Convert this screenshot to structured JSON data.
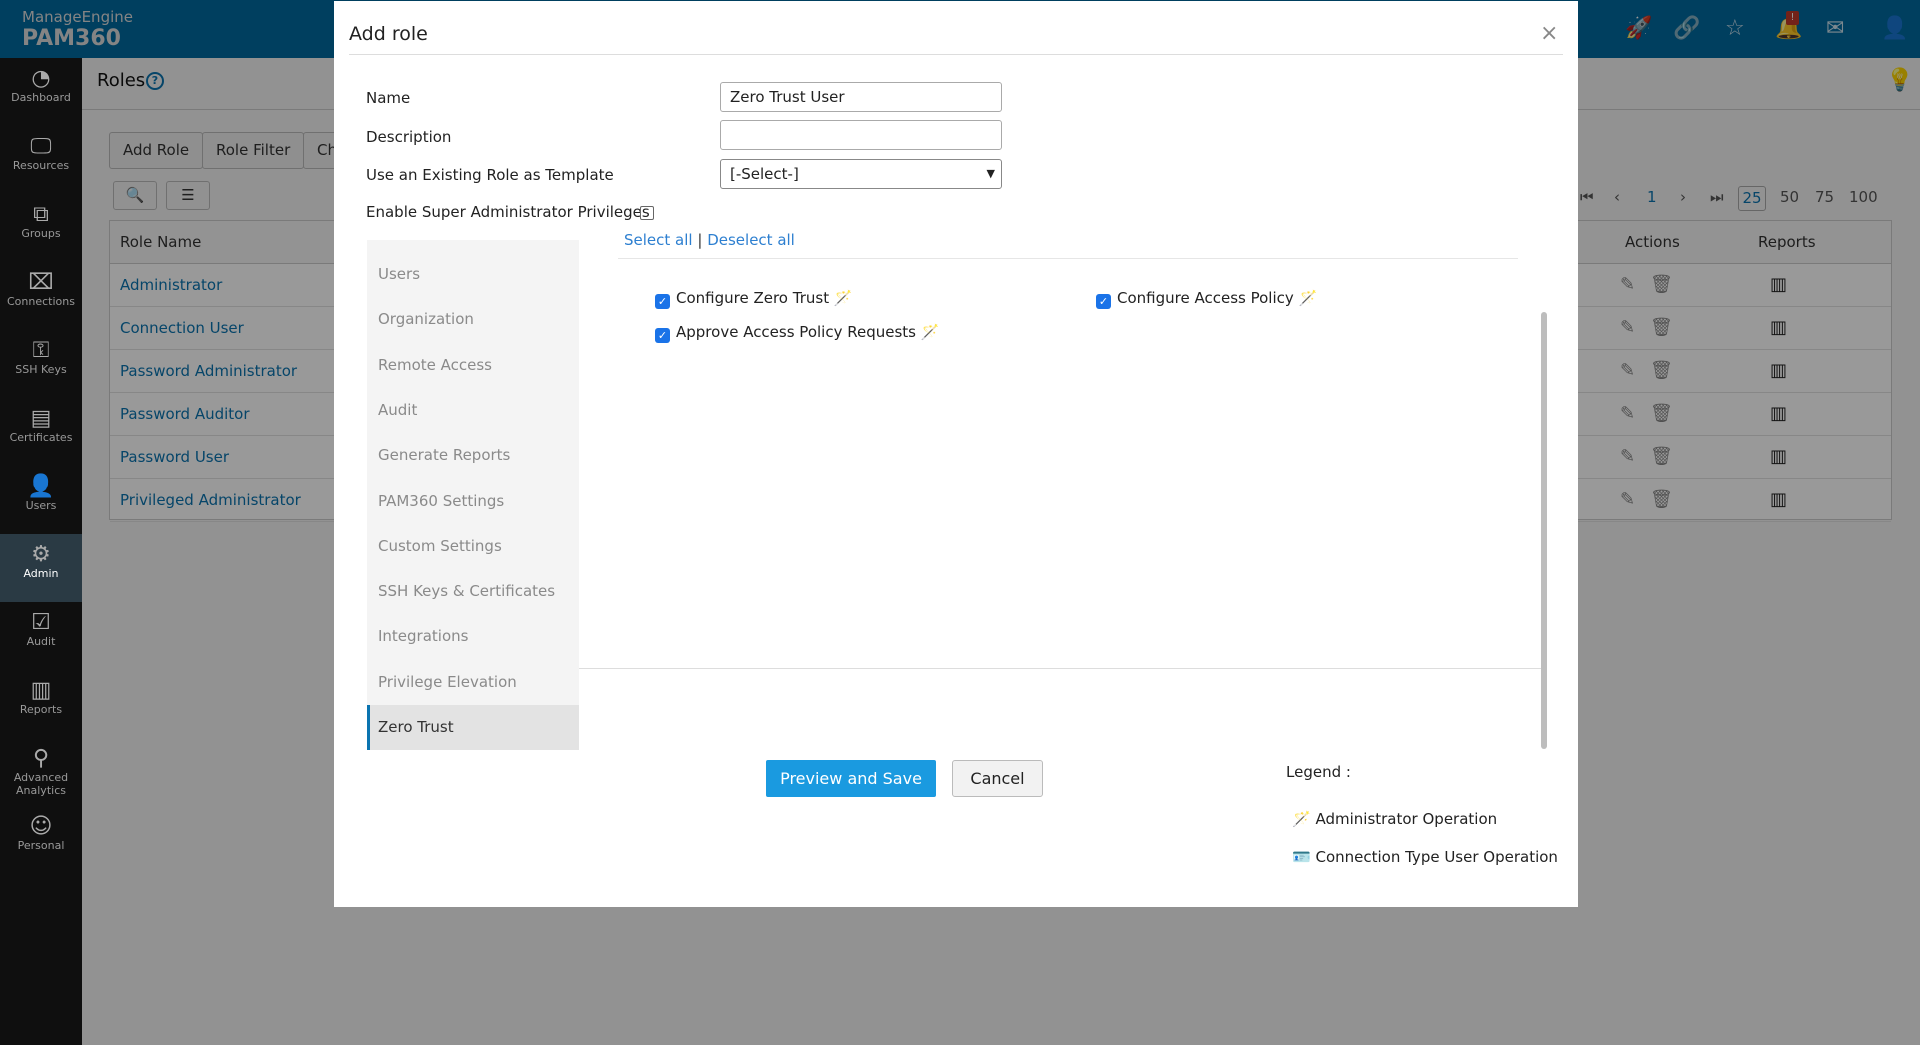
{
  "header": {
    "brand": "ManageEngine",
    "product": "PAM360",
    "icons": [
      "rocket-icon",
      "link-icon",
      "user-star-icon",
      "bell-icon",
      "mail-icon",
      "user-icon"
    ],
    "notification_badge": "!"
  },
  "sidebar": {
    "items": [
      {
        "label": "Dashboard",
        "icon": "◔"
      },
      {
        "label": "Resources",
        "icon": "🖵"
      },
      {
        "label": "Groups",
        "icon": "⧉"
      },
      {
        "label": "Connections",
        "icon": "⌧"
      },
      {
        "label": "SSH Keys",
        "icon": "⚿"
      },
      {
        "label": "Certificates",
        "icon": "▤"
      },
      {
        "label": "Users",
        "icon": "👤"
      },
      {
        "label": "Admin",
        "icon": "⚙",
        "active": true
      },
      {
        "label": "Audit",
        "icon": "☑"
      },
      {
        "label": "Reports",
        "icon": "▥"
      },
      {
        "label": "Advanced Analytics",
        "icon": "⚲"
      },
      {
        "label": "Personal",
        "icon": "☺"
      }
    ]
  },
  "page": {
    "title": "Roles",
    "help": "?",
    "toolbar": {
      "add_role": "Add Role",
      "role_filter": "Role Filter",
      "third": "Ch"
    },
    "table": {
      "headers": {
        "role_name": "Role Name",
        "actions": "Actions",
        "reports": "Reports"
      },
      "rows": [
        "Administrator",
        "Connection User",
        "Password Administrator",
        "Password Auditor",
        "Password User",
        "Privileged Administrator"
      ]
    },
    "pagination": {
      "current": "1",
      "sizes": [
        "25",
        "50",
        "75",
        "100"
      ],
      "selected": "25"
    }
  },
  "modal": {
    "title": "Add role",
    "close": "×",
    "form": {
      "name_label": "Name",
      "name_value": "Zero Trust User",
      "description_label": "Description",
      "description_value": "",
      "template_label": "Use an Existing Role as Template",
      "template_value": "[-Select-]",
      "super_admin_label": "Enable Super Administrator Privileges",
      "super_admin_checked": false
    },
    "nav": [
      {
        "label": "Users"
      },
      {
        "label": "Organization"
      },
      {
        "label": "Remote Access"
      },
      {
        "label": "Audit"
      },
      {
        "label": "Generate Reports"
      },
      {
        "label": "PAM360 Settings"
      },
      {
        "label": "Custom Settings"
      },
      {
        "label": "SSH Keys & Certificates"
      },
      {
        "label": "Integrations"
      },
      {
        "label": "Privilege Elevation"
      },
      {
        "label": "Zero Trust",
        "active": true
      }
    ],
    "select_all": "Select all",
    "separator": "|",
    "deselect_all": "Deselect all",
    "permissions": [
      {
        "label": "Configure Zero Trust",
        "checked": true
      },
      {
        "label": "Configure Access Policy",
        "checked": true
      },
      {
        "label": "Approve Access Policy Requests",
        "checked": true
      }
    ],
    "preview_save": "Preview and Save",
    "cancel": "Cancel",
    "legend": {
      "title": "Legend :",
      "items": [
        "Administrator Operation",
        "Connection Type User Operation"
      ]
    }
  },
  "colors": {
    "accent": "#1a9ae0",
    "header": "#00699f",
    "checkbox": "#1a73e8"
  }
}
